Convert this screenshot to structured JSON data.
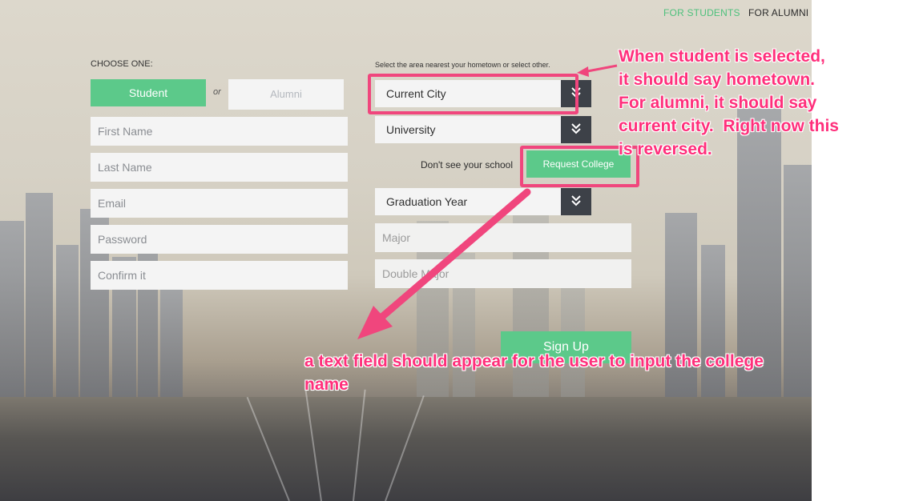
{
  "nav": {
    "students_label": "FOR STUDENTS",
    "alumni_label": "FOR ALUMNI"
  },
  "colors": {
    "accent_green": "#5cc98a",
    "annotation_pink": "#f0467d",
    "select_arrow_bg": "#3d4148"
  },
  "form_left": {
    "choose_label": "CHOOSE ONE:",
    "student_label": "Student",
    "or_label": "or",
    "alumni_label": "Alumni",
    "first_name_placeholder": "First Name",
    "last_name_placeholder": "Last Name",
    "email_placeholder": "Email",
    "password_placeholder": "Password",
    "confirm_placeholder": "Confirm it"
  },
  "form_right": {
    "area_label": "Select the area nearest your hometown or select other.",
    "city_select": "Current City",
    "university_select": "University",
    "dont_see_label": "Don't see your school",
    "request_college_label": "Request College",
    "graduation_select": "Graduation Year",
    "major_placeholder": "Major",
    "double_major_placeholder": "Double Major",
    "signup_label": "Sign Up"
  },
  "annotations": {
    "top_note": "When student is selected,\nit should say hometown.\nFor alumni, it should say\ncurrent city.  Right now this\nis reversed.",
    "bottom_note": "a text field should appear for the user to input the college name"
  },
  "icons": {
    "select_arrow": "double-chevron-down-icon"
  }
}
